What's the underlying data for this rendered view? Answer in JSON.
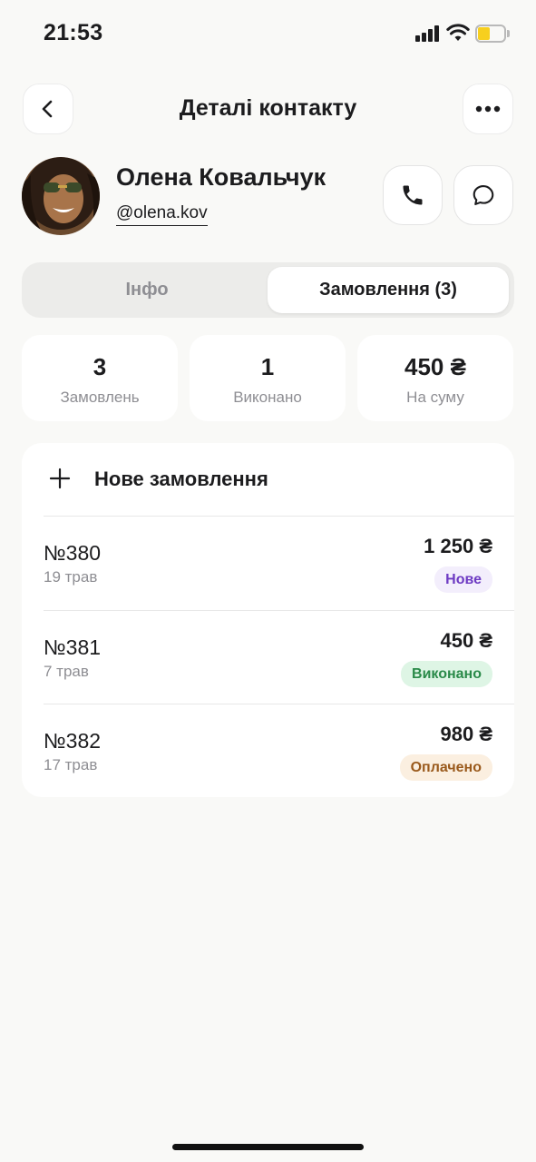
{
  "status_bar": {
    "time": "21:53",
    "battery_level": 0.35,
    "battery_color": "#f7cf1e"
  },
  "header": {
    "title": "Деталі контакту",
    "back_icon": "chevron-left-icon",
    "more_icon": "more-horizontal-icon"
  },
  "contact": {
    "name": "Олена Ковальчук",
    "handle": "@olena.kov",
    "call_icon": "phone-icon",
    "message_icon": "chat-bubble-icon"
  },
  "tabs": [
    {
      "label": "Інфо",
      "active": false
    },
    {
      "label": "Замовлення (3)",
      "active": true
    }
  ],
  "stats": [
    {
      "value": "3",
      "label": "Замовлень"
    },
    {
      "value": "1",
      "label": "Виконано"
    },
    {
      "value": "450 ₴",
      "label": "На суму"
    }
  ],
  "orders": {
    "new_order_label": "Нове замовлення",
    "items": [
      {
        "number": "№380",
        "date": "19 трав",
        "amount": "1 250 ₴",
        "status": "Нове",
        "status_color": "#6e3bc3"
      },
      {
        "number": "№381",
        "date": "7 трав",
        "amount": "450 ₴",
        "status": "Виконано",
        "status_color": "#2a8a49"
      },
      {
        "number": "№382",
        "date": "17 трав",
        "amount": "980 ₴",
        "status": "Оплачено",
        "status_color": "#9a5a1c"
      }
    ]
  }
}
